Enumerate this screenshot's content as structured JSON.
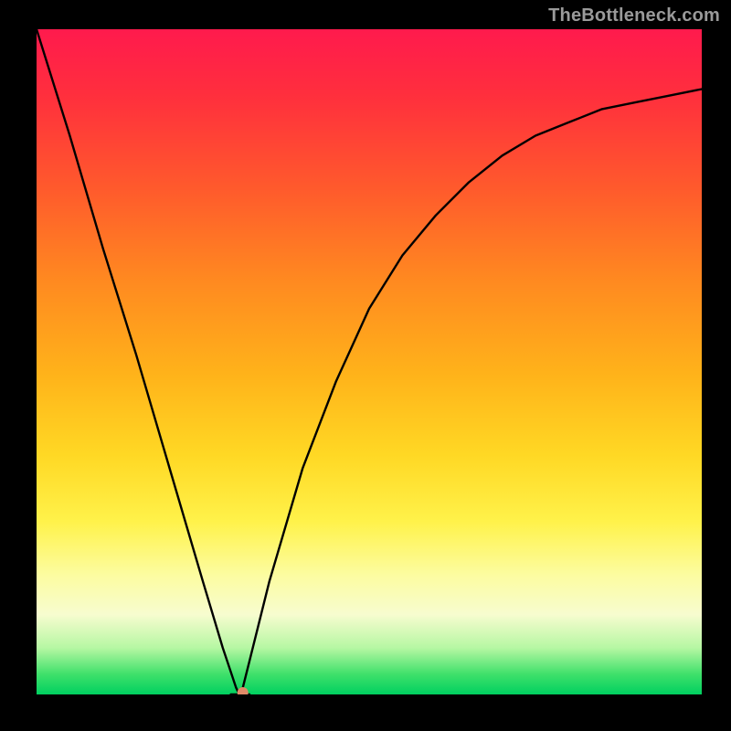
{
  "watermark": "TheBottleneck.com",
  "chart_data": {
    "type": "line",
    "title": "",
    "xlabel": "",
    "ylabel": "",
    "xlim": [
      0,
      1
    ],
    "ylim": [
      0,
      1
    ],
    "series": [
      {
        "name": "curve",
        "x": [
          0.0,
          0.05,
          0.1,
          0.15,
          0.2,
          0.25,
          0.28,
          0.3,
          0.305,
          0.31,
          0.32,
          0.35,
          0.4,
          0.45,
          0.5,
          0.55,
          0.6,
          0.65,
          0.7,
          0.75,
          0.8,
          0.85,
          0.9,
          0.95,
          1.0
        ],
        "y": [
          1.0,
          0.84,
          0.67,
          0.51,
          0.34,
          0.17,
          0.07,
          0.01,
          0.0,
          0.01,
          0.05,
          0.17,
          0.34,
          0.47,
          0.58,
          0.66,
          0.72,
          0.77,
          0.81,
          0.84,
          0.86,
          0.88,
          0.89,
          0.9,
          0.91
        ]
      }
    ],
    "marker": {
      "x": 0.31,
      "y": 0.0,
      "color": "#e08a68"
    },
    "grid": false,
    "legend": false
  }
}
